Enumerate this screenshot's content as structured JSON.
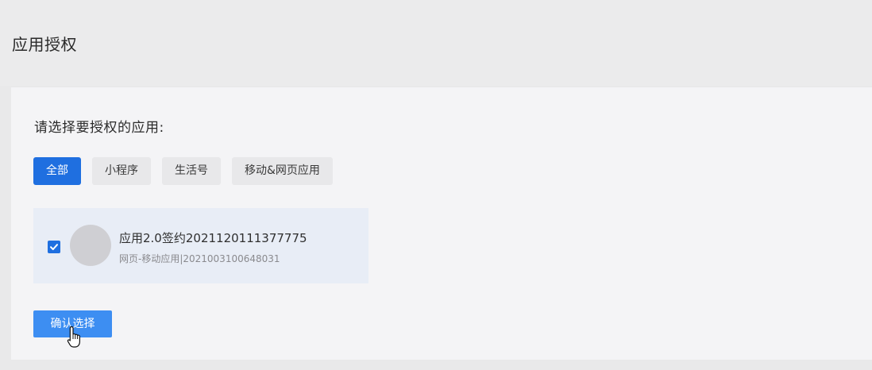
{
  "header": {
    "title": "应用授权"
  },
  "main": {
    "prompt": "请选择要授权的应用:",
    "tabs": [
      {
        "label": "全部",
        "active": true
      },
      {
        "label": "小程序",
        "active": false
      },
      {
        "label": "生活号",
        "active": false
      },
      {
        "label": "移动&网页应用",
        "active": false
      }
    ],
    "app": {
      "checked": true,
      "name": "应用2.0签约2021120111377775",
      "meta": "网页-移动应用|2021003100648031"
    },
    "confirm_label": "确认选择"
  },
  "colors": {
    "accent": "#1f6fe0",
    "button": "#3d8ef2"
  },
  "icons": {
    "checkbox": "check-icon",
    "cursor": "hand-pointer-icon"
  }
}
